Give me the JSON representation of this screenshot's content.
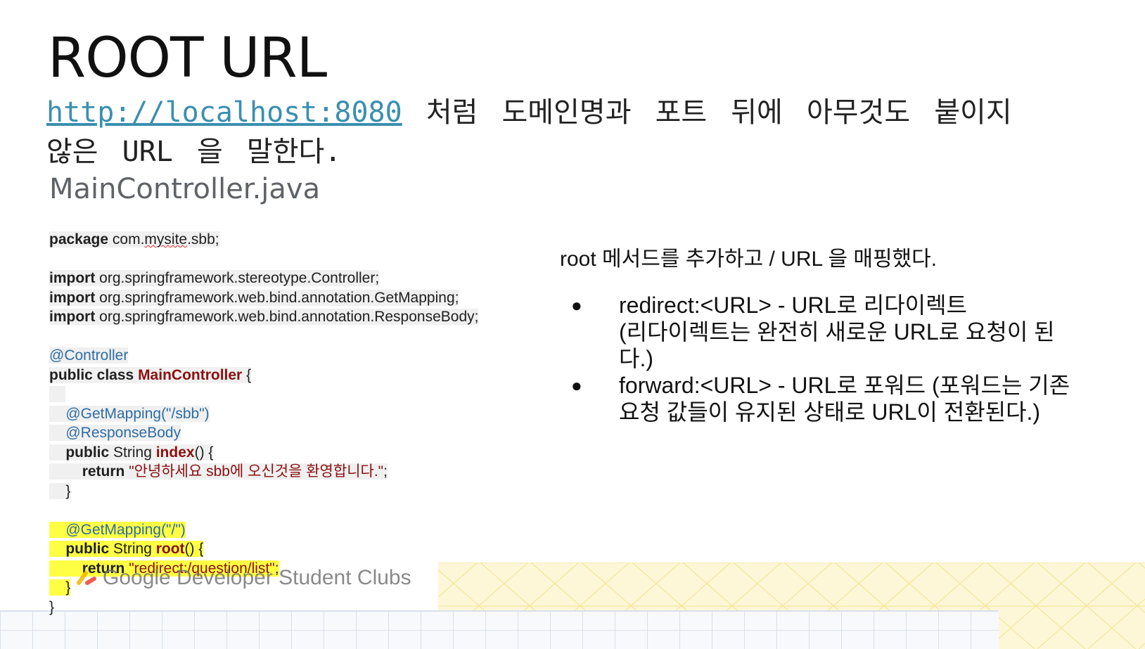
{
  "slide": {
    "title": "ROOT URL",
    "intro_link": "http://localhost:8080",
    "intro_text": " 처럼 도메인명과 포트 뒤에 아무것도 붙이지 않은 URL 을 말한다.",
    "filename": "MainController.java"
  },
  "code": {
    "package_kw": "package",
    "package_pre": " com.",
    "package_squiggle": "mysite",
    "package_post": ".sbb;",
    "import_kw": "import",
    "import1": " org.springframework.stereotype.Controller;",
    "import2": " org.springframework.web.bind.annotation.GetMapping;",
    "import3": " org.springframework.web.bind.annotation.ResponseBody;",
    "annot_controller": "@Controller",
    "class_kw": "public class",
    "class_name": "MainController",
    "class_brace": " {",
    "annot_getmapping_sbb": "@GetMapping(\"/sbb\")",
    "annot_responsebody": "@ResponseBody",
    "public_kw": "public",
    "string_type": " String ",
    "method_index": "index",
    "method_sig_end": "() {",
    "return_kw": "return",
    "return_index_value": "\"안녕하세요 sbb에 오신것을 환영합니다.\"",
    "semicolon": ";",
    "close_brace": "}",
    "annot_getmapping_root": "@GetMapping(\"/\")",
    "method_root": "root",
    "return_root_value": "\"redirect:/question/list\""
  },
  "right": {
    "lead": "root 메서드를 추가하고 / URL 을 매핑했다.",
    "bullet_symbol": "●",
    "bullets": [
      {
        "line1": "redirect:<URL> - URL로 리다이렉트",
        "line2": "(리다이렉트는 완전히 새로운 URL로 요청이 된다.)"
      },
      {
        "line1": "forward:<URL> - URL로 포워드 (포워드는 기존",
        "line2": "요청 값들이 유지된 상태로 URL이 전환된다.)"
      }
    ]
  },
  "footer": {
    "logo_text": "Google Developer Student Clubs"
  },
  "colors": {
    "link": "#3a8fb0",
    "annotation": "#2e6da4",
    "identifier_red": "#8b1010",
    "highlight_yellow": "#ffff44",
    "code_bg": "#f0f0f0"
  }
}
